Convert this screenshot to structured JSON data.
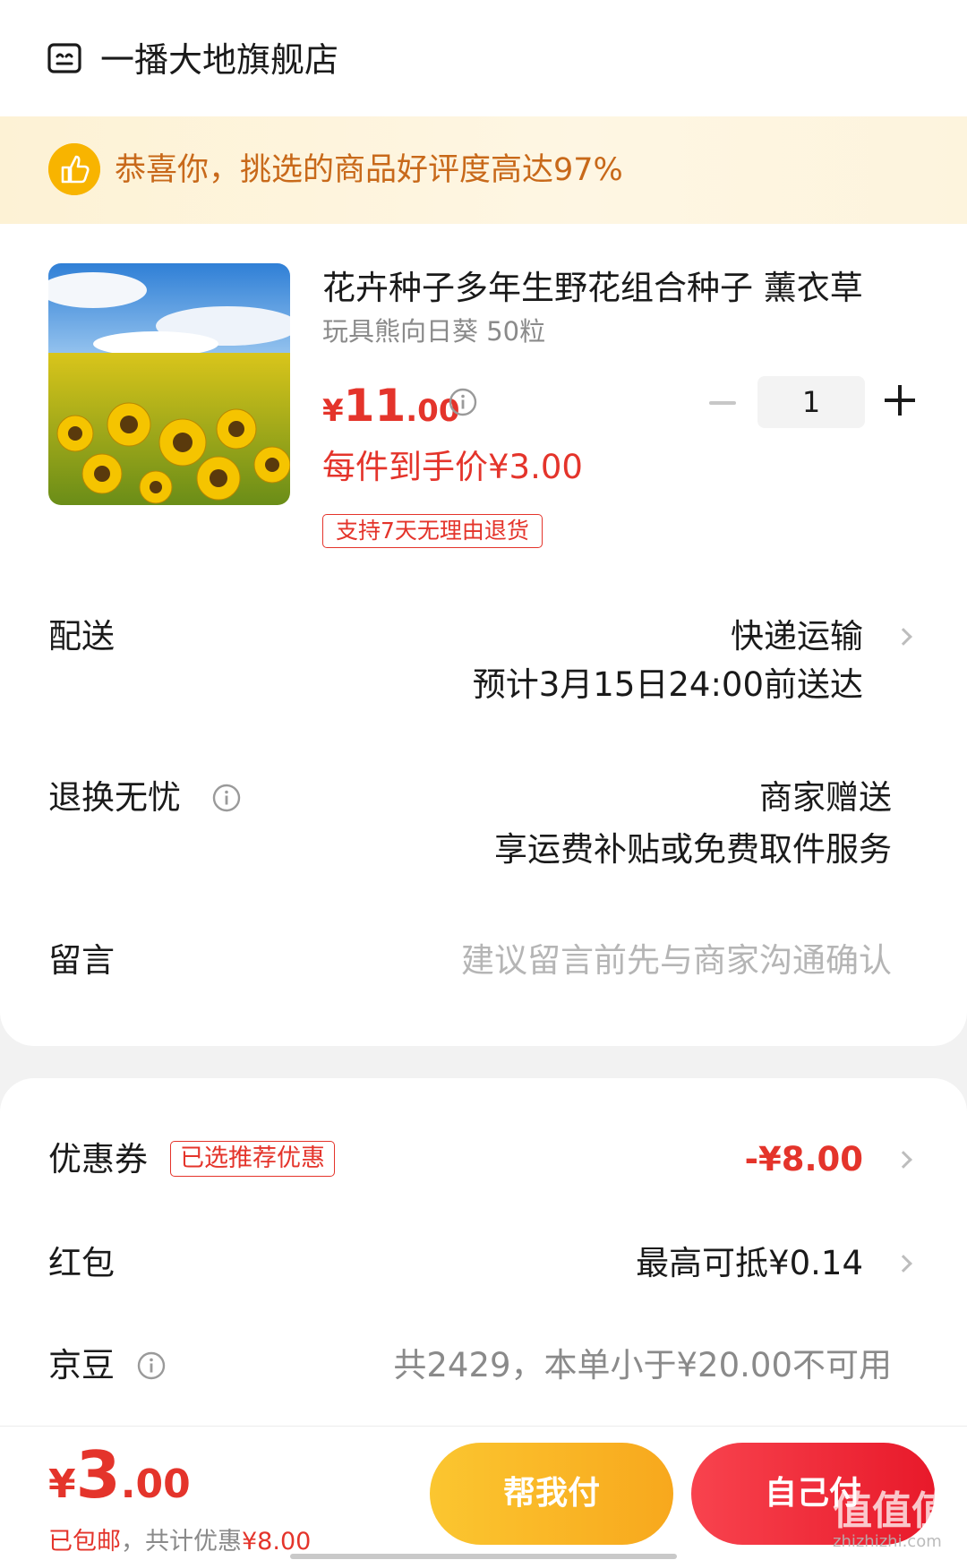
{
  "store": {
    "name": "一播大地旗舰店",
    "icon": "store-icon"
  },
  "praise": {
    "text": "恭喜你，挑选的商品好评度高达97%",
    "icon": "thumbs-up-icon"
  },
  "product": {
    "title": "花卉种子多年生野花组合种子 薰衣草",
    "spec": "玩具熊向日葵 50粒",
    "price_currency": "¥",
    "price_int": "11",
    "price_dec": ".00",
    "net_price": "每件到手价¥3.00",
    "return_tag": "支持7天无理由退货",
    "quantity": "1"
  },
  "delivery": {
    "label": "配送",
    "method": "快递运输",
    "eta": "预计3月15日24:00前送达"
  },
  "returns": {
    "label": "退换无忧",
    "value": "商家赠送",
    "desc": "享运费补贴或免费取件服务"
  },
  "message": {
    "label": "留言",
    "placeholder": "建议留言前先与商家沟通确认"
  },
  "coupon": {
    "label": "优惠券",
    "tag": "已选推荐优惠",
    "amount": "-¥8.00"
  },
  "red_packet": {
    "label": "红包",
    "value": "最高可抵¥0.14"
  },
  "jd_beans": {
    "label": "京豆",
    "value": "共2429，本单小于¥20.00不可用"
  },
  "footer": {
    "total_currency": "¥",
    "total_int": "3",
    "total_dec": ".00",
    "note_left": "已包邮",
    "note_mid": "，共计优惠",
    "note_right": "¥8.00",
    "help_pay": "帮我付",
    "self_pay": "自己付"
  },
  "watermark": {
    "text": "值值值",
    "sub": "zhizhizhi.com"
  },
  "colors": {
    "accent_red": "#e4342b",
    "praise_orange": "#c8691a",
    "help_yellow": "#fbc630"
  }
}
